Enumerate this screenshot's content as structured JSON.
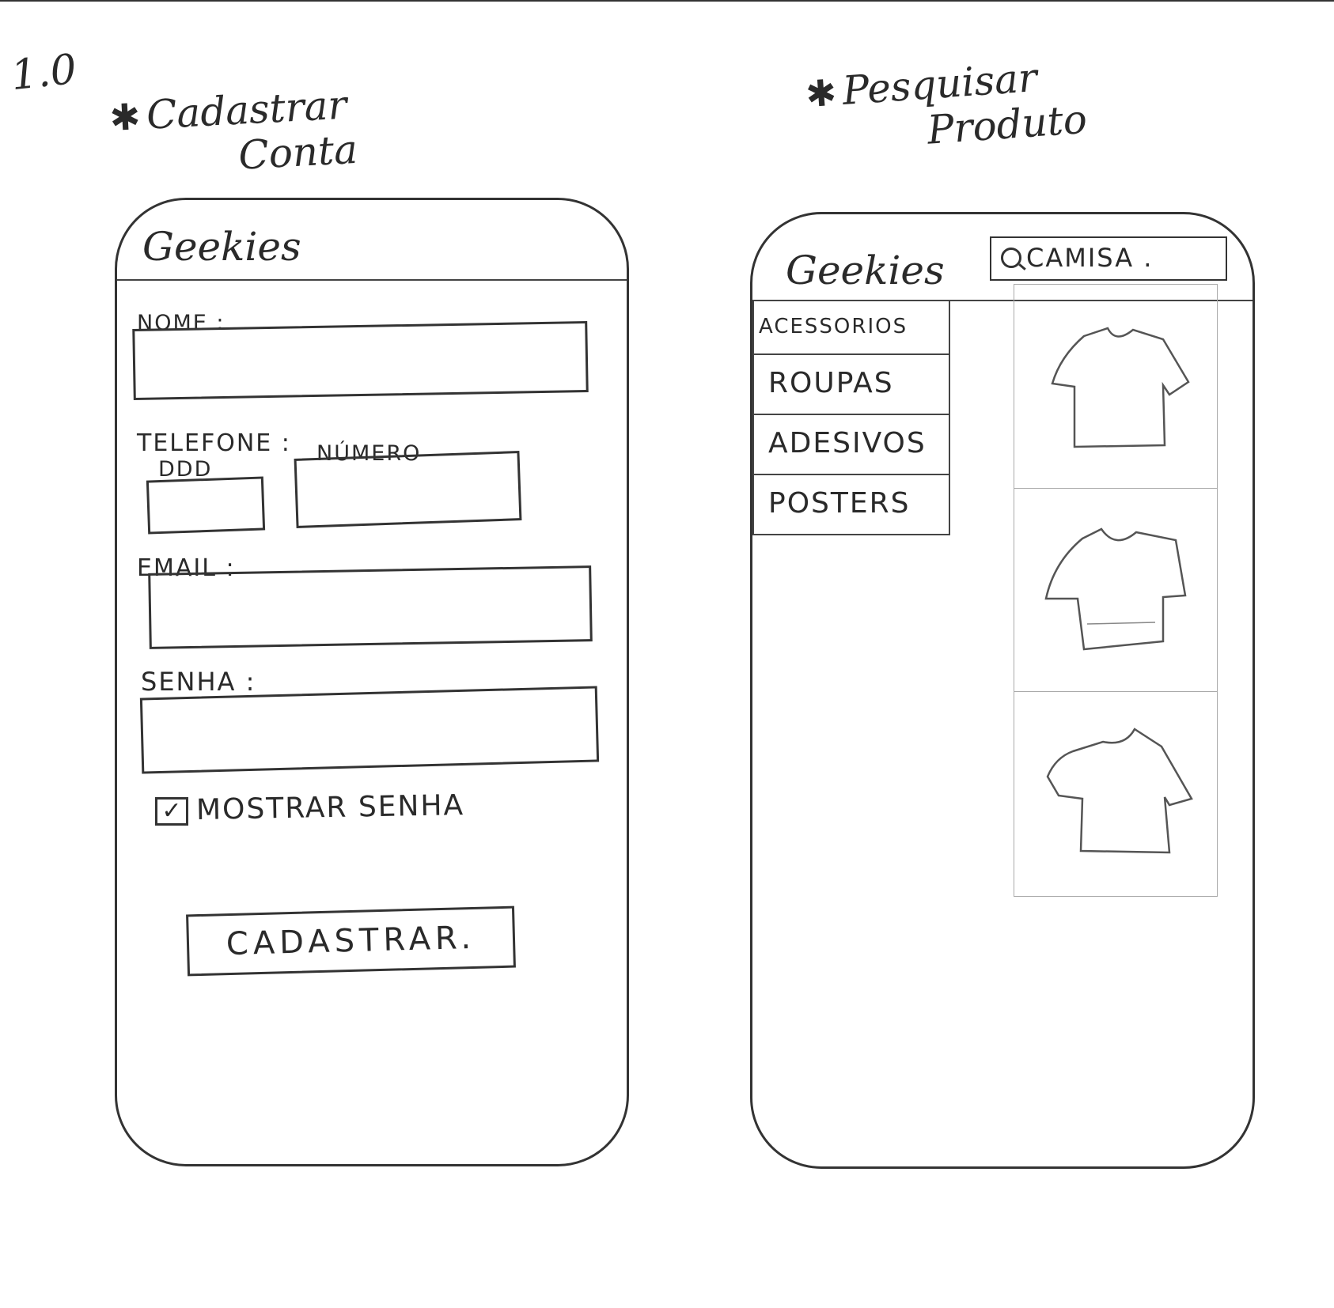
{
  "page": {
    "version": "1.0"
  },
  "headings": {
    "left": {
      "line1": "Cadastrar",
      "line2": "Conta"
    },
    "right": {
      "line1": "Pesquisar",
      "line2": "Produto"
    }
  },
  "signup": {
    "brand": "Geekies",
    "name_label": "NOME :",
    "phone_label": "TELEFONE :",
    "ddd_label": "DDD",
    "number_label": "NÚMERO",
    "email_label": "EMAIL :",
    "password_label": "SENHA :",
    "show_password_label": "MOSTRAR SENHA",
    "show_password_checked": true,
    "submit_label": "CADASTRAR."
  },
  "search_screen": {
    "brand": "Geekies",
    "search_value": "CAMISA .",
    "categories": [
      "ACESSORIOS",
      "ROUPAS",
      "ADESIVOS",
      "POSTERS"
    ],
    "results": [
      {
        "icon": "tshirt-icon"
      },
      {
        "icon": "tshirt-icon"
      },
      {
        "icon": "tshirt-icon"
      }
    ]
  }
}
